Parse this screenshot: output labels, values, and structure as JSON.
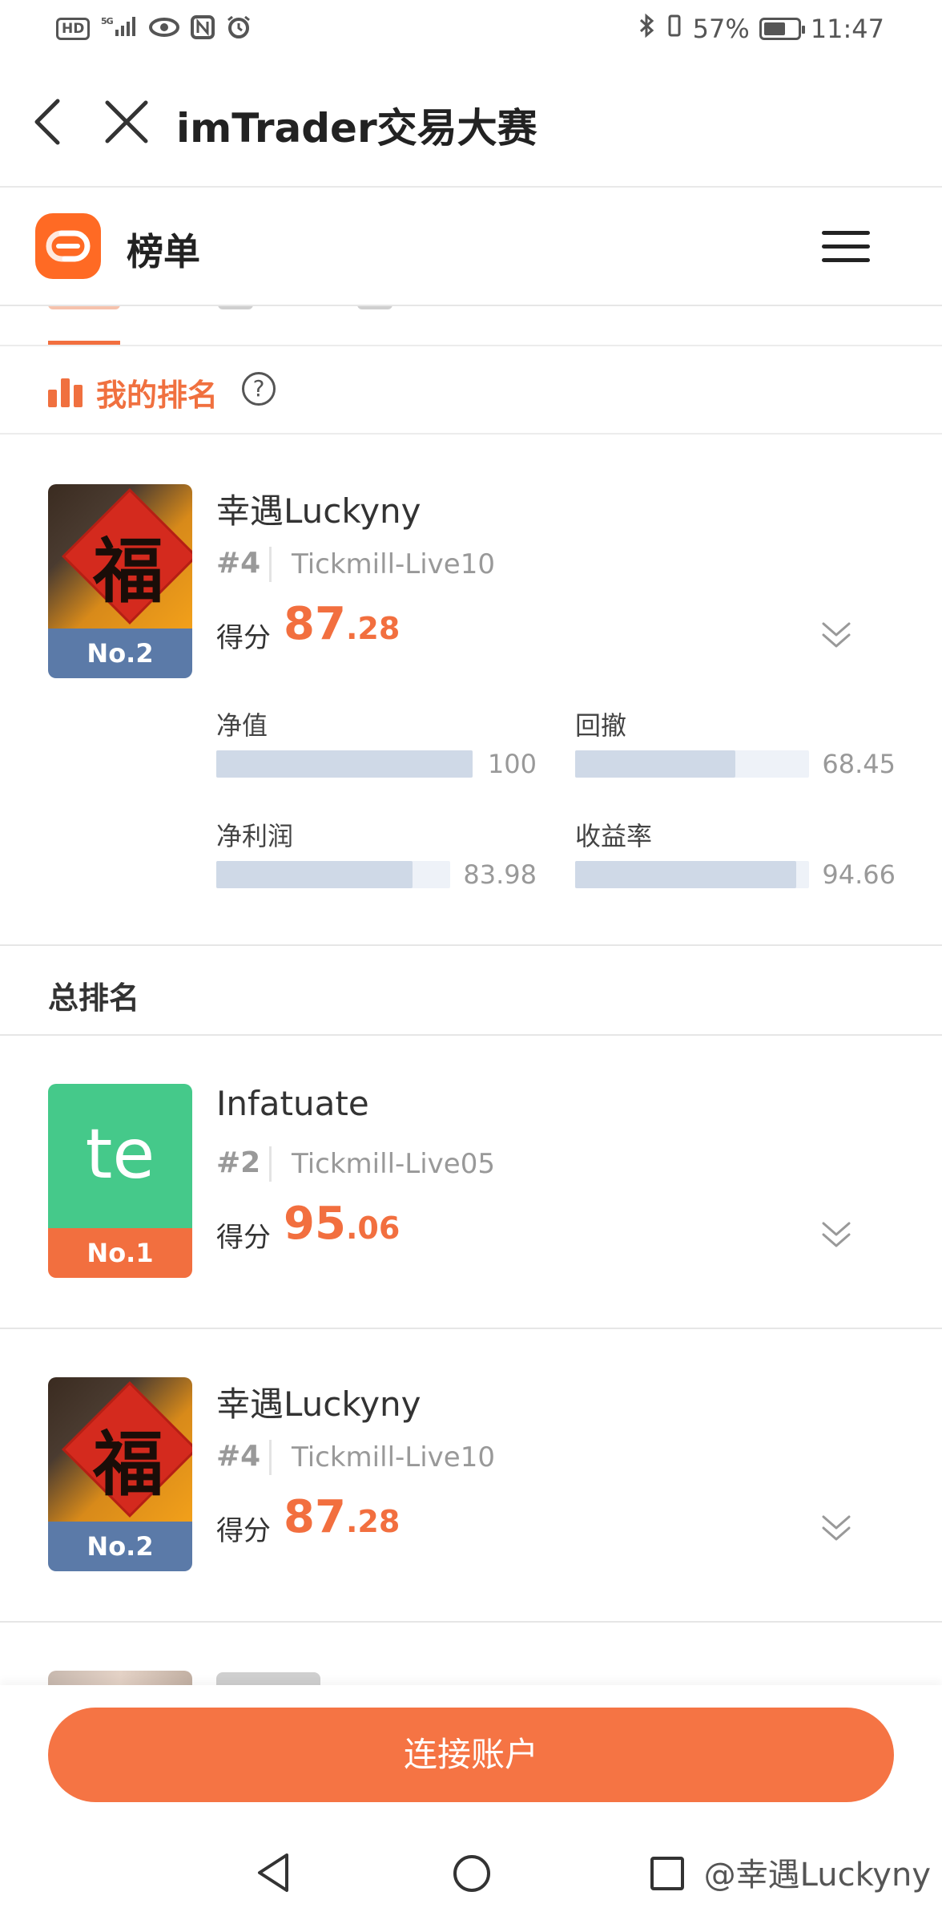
{
  "status_bar": {
    "hd": "HD",
    "network": "5G",
    "battery_pct": "57%",
    "time": "11:47"
  },
  "nav": {
    "title": "imTrader交易大赛",
    "back_icon": "chevron-left-icon",
    "close_icon": "close-icon"
  },
  "subheader": {
    "title": "榜单",
    "menu_icon": "hamburger-icon",
    "logo_color": "#ff6a24"
  },
  "my_ranking": {
    "label": "我的排名",
    "help": "?",
    "card": {
      "name": "幸遇Luckyny",
      "rank": "#4",
      "server": "Tickmill-Live10",
      "badge": "No.2",
      "score_label": "得分",
      "score_int": "87",
      "score_dec": ".28",
      "metrics": [
        {
          "label": "净值",
          "value": "100",
          "fill": 1.0
        },
        {
          "label": "回撤",
          "value": "68.45",
          "fill": 0.6845
        },
        {
          "label": "净利润",
          "value": "83.98",
          "fill": 0.8398
        },
        {
          "label": "收益率",
          "value": "94.66",
          "fill": 0.9466
        }
      ]
    }
  },
  "overall": {
    "title": "总排名",
    "entries": [
      {
        "name": "Infatuate",
        "avatar_text": "te",
        "rank": "#2",
        "server": "Tickmill-Live05",
        "badge": "No.1",
        "score_label": "得分",
        "score_int": "95",
        "score_dec": ".06"
      },
      {
        "name": "幸遇Luckyny",
        "rank": "#4",
        "server": "Tickmill-Live10",
        "badge": "No.2",
        "score_label": "得分",
        "score_int": "87",
        "score_dec": ".28"
      }
    ]
  },
  "avatar_glyph": "福",
  "connect_button": "连接账户",
  "watermark": "@幸遇Luckyny",
  "colors": {
    "accent": "#f26f3f",
    "button": "#f57444",
    "badge_blue": "#5b7aa8",
    "avatar_green": "#45c98a"
  }
}
